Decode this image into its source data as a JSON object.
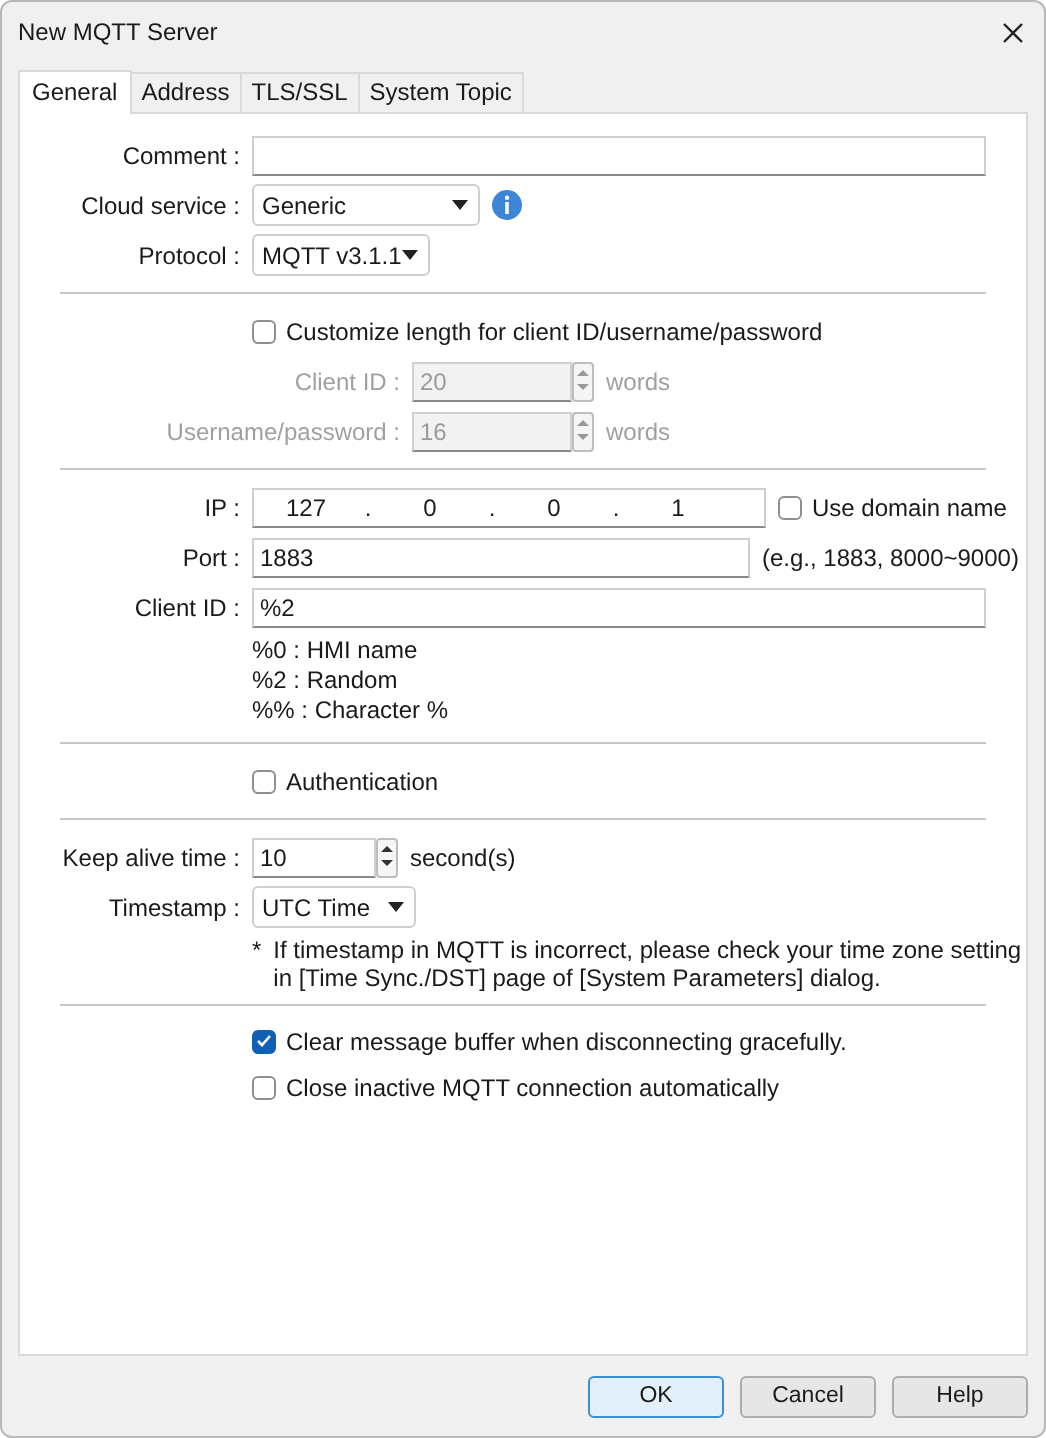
{
  "window": {
    "title": "New MQTT Server"
  },
  "tabs": [
    {
      "label": "General",
      "selected": true
    },
    {
      "label": "Address",
      "selected": false
    },
    {
      "label": "TLS/SSL",
      "selected": false
    },
    {
      "label": "System Topic",
      "selected": false
    }
  ],
  "comment": {
    "label": "Comment :"
  },
  "cloud_service": {
    "label": "Cloud service :",
    "value": "Generic"
  },
  "protocol": {
    "label": "Protocol :",
    "value": "MQTT v3.1.1"
  },
  "customize_length": {
    "label": "Customize length for client ID/username/password",
    "checked": false
  },
  "length_fields": [
    {
      "label": "Client ID :",
      "value": "20",
      "unit": "words",
      "disabled": true
    },
    {
      "label": "Username/password :",
      "value": "16",
      "unit": "words",
      "disabled": true
    }
  ],
  "ip": {
    "label": "IP :",
    "octets": [
      "127",
      "0",
      "0",
      "1"
    ],
    "separator": "."
  },
  "use_domain_name": {
    "label": "Use domain name",
    "checked": false
  },
  "port": {
    "label": "Port :",
    "value": "1883",
    "hint": "(e.g., 1883, 8000~9000)"
  },
  "client_id": {
    "label": "Client ID :",
    "value": "%2",
    "legend": [
      "%0 : HMI name",
      "%2 : Random",
      "%% : Character %"
    ]
  },
  "authentication": {
    "label": "Authentication",
    "checked": false
  },
  "keep_alive": {
    "label": "Keep alive time :",
    "value": "10",
    "unit": "second(s)"
  },
  "timestamp": {
    "label": "Timestamp :",
    "value": "UTC Time",
    "note_mark": "*",
    "note": [
      "If timestamp in MQTT is incorrect, please check your time zone setting",
      "in [Time Sync./DST] page of [System Parameters] dialog."
    ]
  },
  "options": [
    {
      "label": "Clear message buffer when disconnecting gracefully.",
      "checked": true
    },
    {
      "label": "Close inactive MQTT connection automatically",
      "checked": false
    }
  ],
  "buttons": [
    {
      "label": "OK",
      "default": true
    },
    {
      "label": "Cancel",
      "default": false
    },
    {
      "label": "Help",
      "default": false
    }
  ]
}
